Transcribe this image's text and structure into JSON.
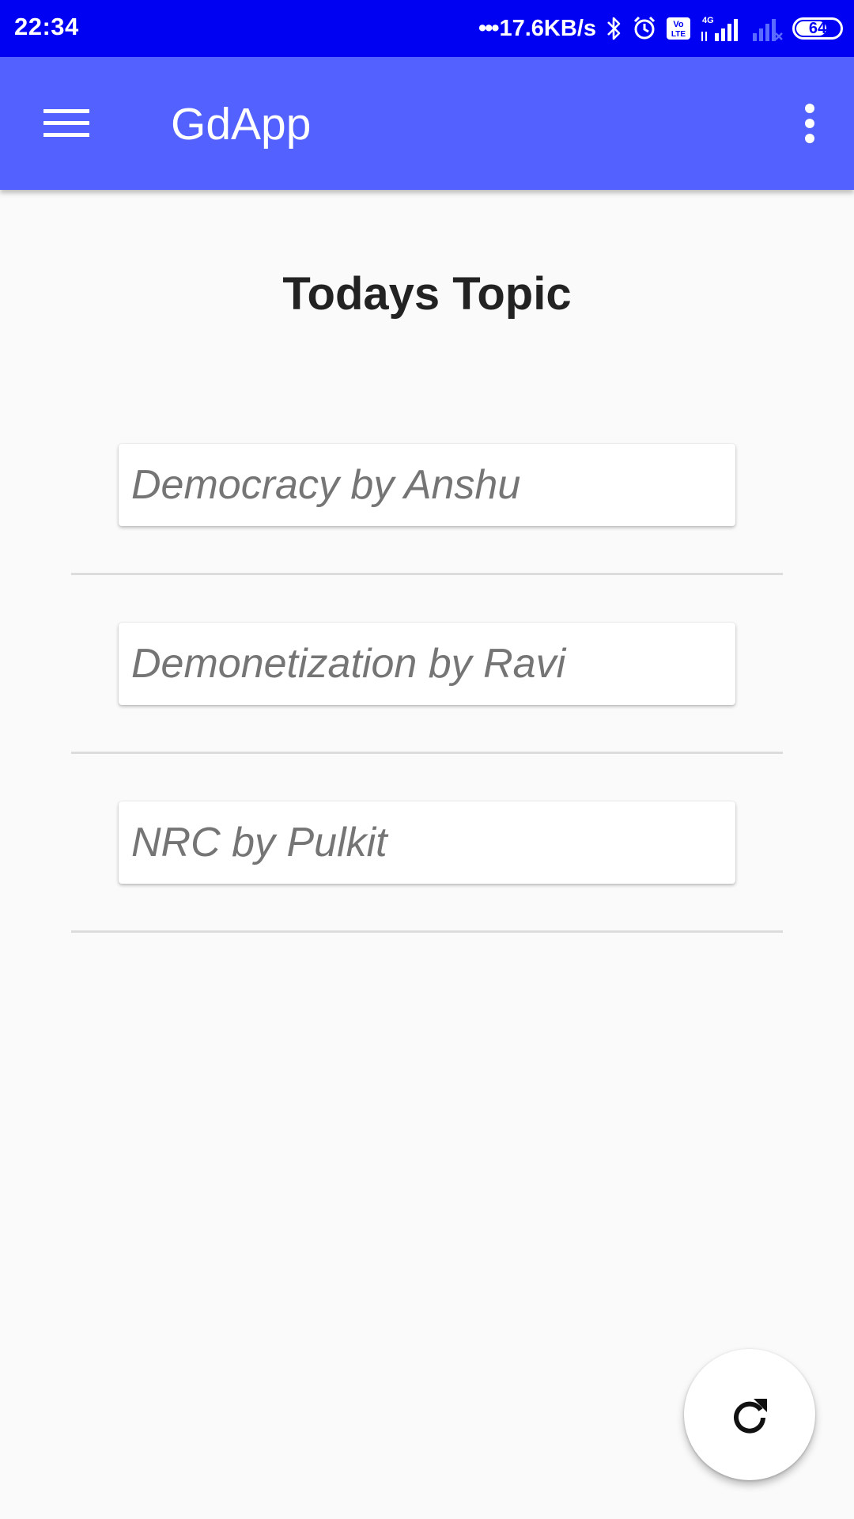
{
  "status_bar": {
    "time": "22:34",
    "network_speed": "17.6KB/s",
    "network_dots": "•••",
    "battery_level": "64",
    "icons": [
      "bluetooth-icon",
      "alarm-icon",
      "volte-icon",
      "signal-4g-icon",
      "signal-weak-icon",
      "battery-icon"
    ]
  },
  "app_bar": {
    "title": "GdApp",
    "left_icon": "hamburger-menu-icon",
    "right_icon": "overflow-menu-icon",
    "color": "#5361ff"
  },
  "main": {
    "title": "Todays Topic",
    "topics": [
      {
        "label": "Democracy by Anshu"
      },
      {
        "label": "Demonetization by Ravi"
      },
      {
        "label": "NRC by Pulkit"
      }
    ]
  },
  "fab": {
    "icon": "refresh-icon"
  },
  "colors": {
    "status_bar": "#0000f2",
    "app_bar": "#5361ff",
    "background": "#fafafa",
    "topic_text": "#757575"
  }
}
